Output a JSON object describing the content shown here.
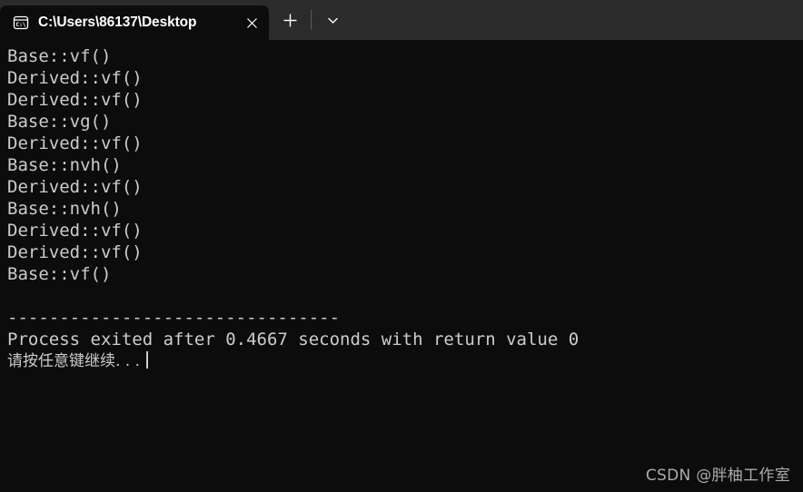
{
  "window": {
    "background_color": "#0c0c0c",
    "titlebar_color": "#2b2b2b",
    "text_color": "#cccccc"
  },
  "titlebar": {
    "tab": {
      "icon_name": "console-cmd-icon",
      "icon_label": "C:\\",
      "title": "C:\\Users\\86137\\Desktop",
      "close_label": "✕",
      "close_name": "tab-close-button"
    },
    "new_tab_label": "+",
    "dropdown_label": "⌄"
  },
  "terminal": {
    "lines": [
      "Base::vf()",
      "Derived::vf()",
      "Derived::vf()",
      "Base::vg()",
      "Derived::vf()",
      "Base::nvh()",
      "Derived::vf()",
      "Base::nvh()",
      "Derived::vf()",
      "Derived::vf()",
      "Base::vf()"
    ],
    "blank_line": " ",
    "separator": "--------------------------------",
    "exit_message": "Process exited after 0.4667 seconds with return value 0",
    "prompt_message": "请按任意键继续. . ."
  },
  "watermark": {
    "text": "CSDN @胖柚工作室"
  }
}
